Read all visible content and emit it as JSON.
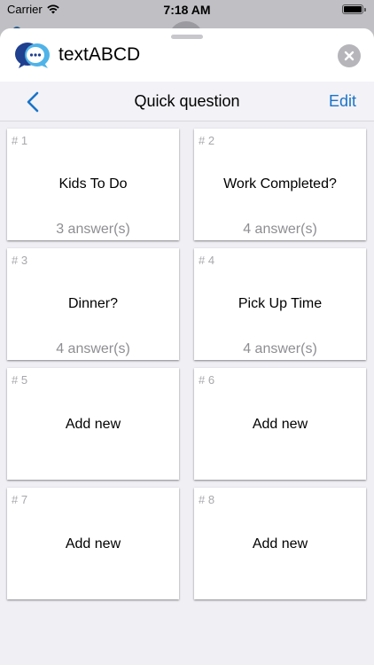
{
  "status_bar": {
    "carrier": "Carrier",
    "time": "7:18 AM"
  },
  "header": {
    "app_title": "textABCD",
    "logo_icon": "chat-bubble-logo-icon",
    "close_icon": "close-icon"
  },
  "nav": {
    "title": "Quick question",
    "back_icon": "chevron-left-icon",
    "edit_label": "Edit"
  },
  "colors": {
    "accent": "#1a73c9",
    "logo_dark": "#1f3f8f",
    "logo_light": "#4fb3e8"
  },
  "cards": [
    {
      "number": "# 1",
      "title": "Kids To Do",
      "answers": "3 answer(s)"
    },
    {
      "number": "# 2",
      "title": "Work Completed?",
      "answers": "4 answer(s)"
    },
    {
      "number": "# 3",
      "title": "Dinner?",
      "answers": "4 answer(s)"
    },
    {
      "number": "# 4",
      "title": "Pick Up Time",
      "answers": "4 answer(s)"
    },
    {
      "number": "# 5",
      "title": "Add new",
      "answers": ""
    },
    {
      "number": "# 6",
      "title": "Add new",
      "answers": ""
    },
    {
      "number": "# 7",
      "title": "Add new",
      "answers": ""
    },
    {
      "number": "# 8",
      "title": "Add new",
      "answers": ""
    }
  ]
}
